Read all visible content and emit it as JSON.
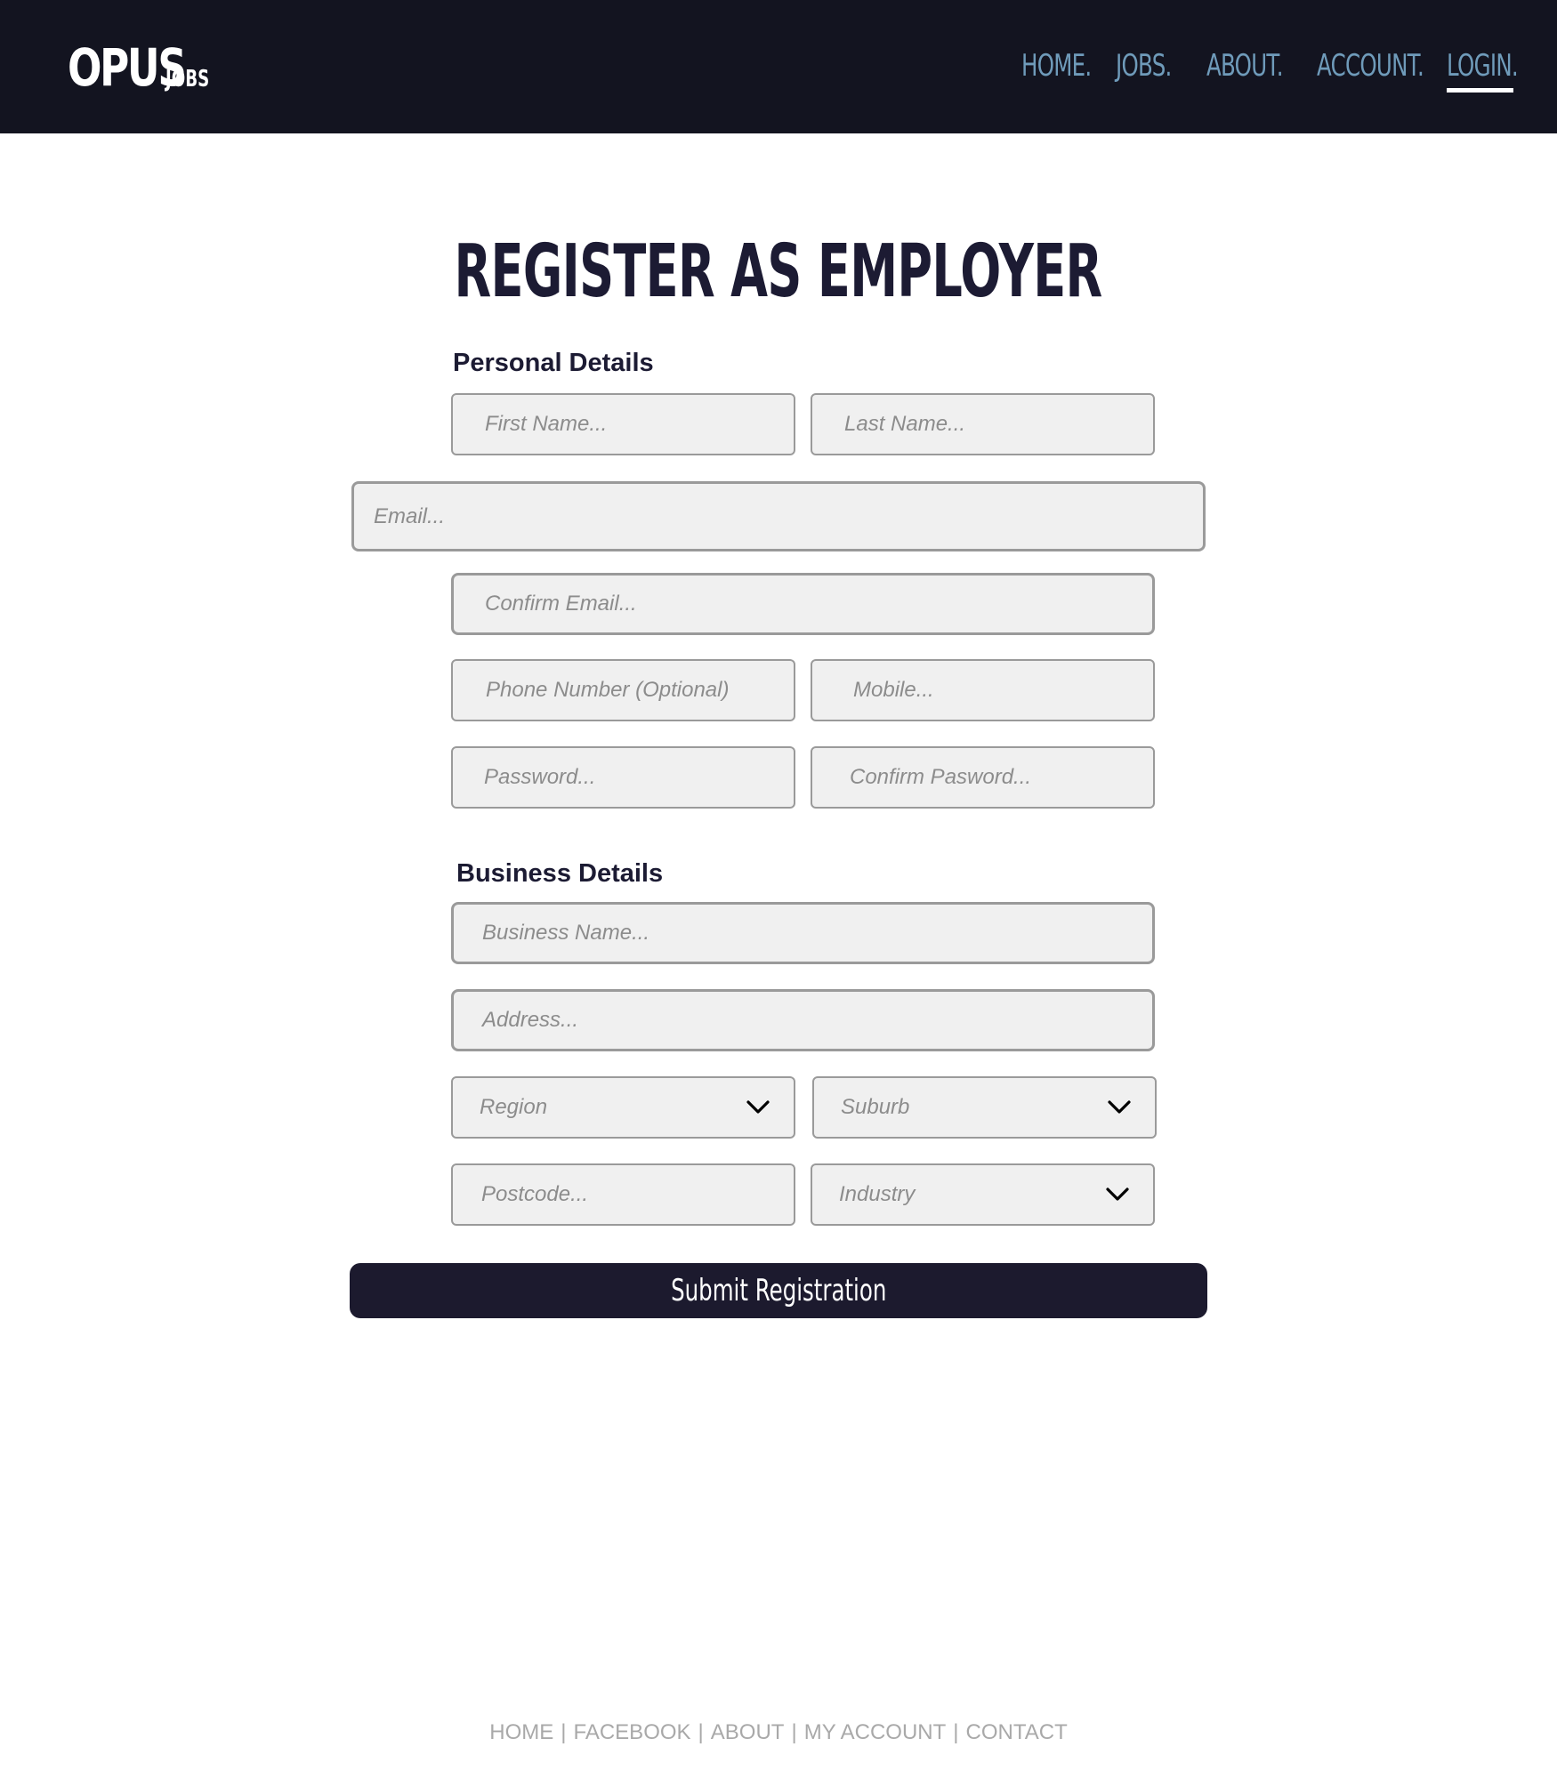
{
  "header": {
    "logo": {
      "main": "OPUS",
      "sub": "JOBS"
    },
    "nav": [
      {
        "label": "HOME."
      },
      {
        "label": "JOBS."
      },
      {
        "label": "ABOUT."
      },
      {
        "label": "ACCOUNT."
      },
      {
        "label": "LOGIN.",
        "active": true
      }
    ]
  },
  "page": {
    "title": "REGISTER AS EMPLOYER"
  },
  "personal": {
    "heading": "Personal Details",
    "first_name": "First Name...",
    "last_name": "Last Name...",
    "email": "Email...",
    "confirm_email": "Confirm Email...",
    "phone": "Phone Number (Optional)",
    "mobile": "Mobile...",
    "password": "Password...",
    "confirm_password": "Confirm Pasword..."
  },
  "business": {
    "heading": "Business Details",
    "business_name": "Business Name...",
    "address": "Address...",
    "region": "Region",
    "suburb": "Suburb",
    "postcode": "Postcode...",
    "industry": "Industry"
  },
  "submit_label": "Submit Registration",
  "footer": {
    "links": [
      "HOME",
      "FACEBOOK",
      "ABOUT",
      "MY ACCOUNT",
      "CONTACT"
    ],
    "separator": "|"
  },
  "colors": {
    "header_bg": "#131420",
    "nav_link": "#6f9bba",
    "title": "#1c1b33",
    "button_bg": "#1c1a2e",
    "footer_text": "#a9a9a9"
  },
  "icons": {
    "dropdown": "chevron-down-icon"
  }
}
